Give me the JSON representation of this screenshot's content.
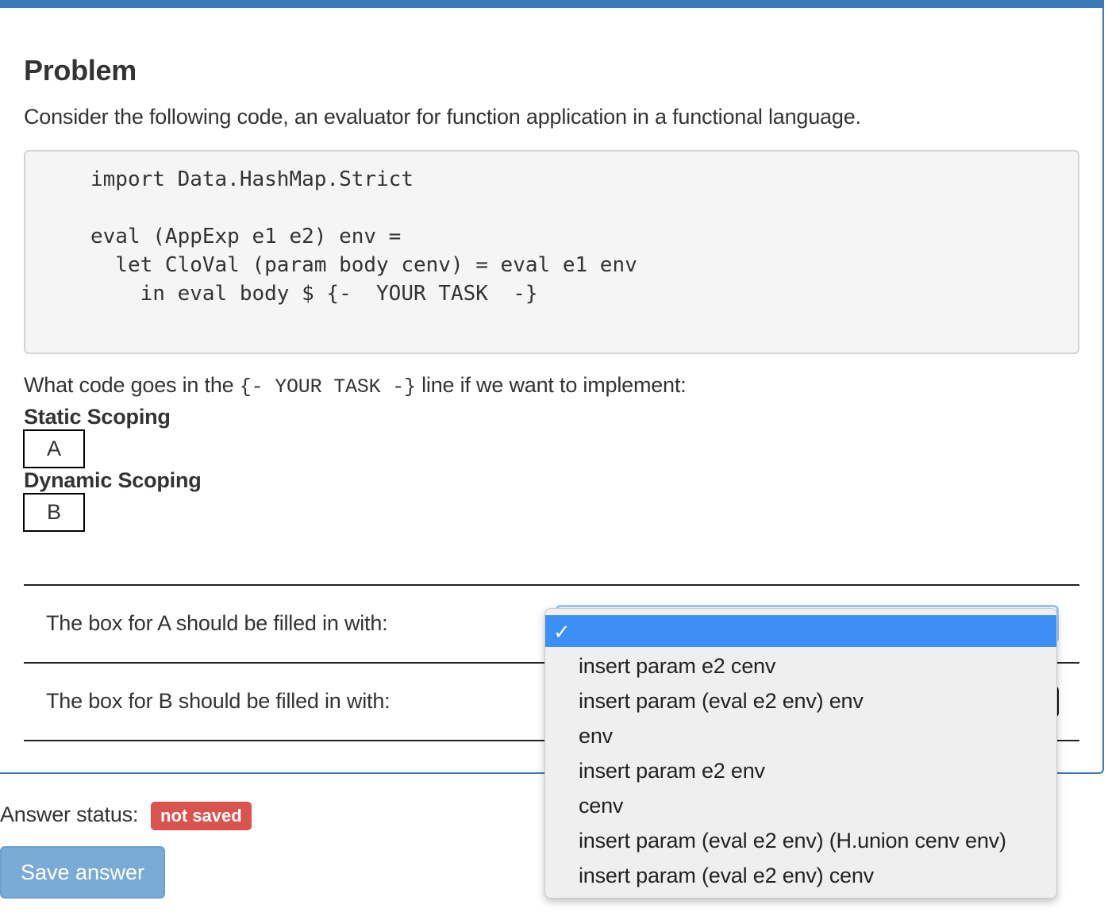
{
  "problem": {
    "title": "Problem",
    "intro": "Consider the following code, an evaluator for function application in a functional language.",
    "code_lines": [
      "import Data.HashMap.Strict",
      "eval (AppExp e1 e2) env =",
      "  let CloVal (param body cenv) = eval e1 env",
      "    in eval body $ {-  YOUR TASK  -}"
    ],
    "question_before": "What code goes in the ",
    "question_code": "{- YOUR TASK -}",
    "question_after": " line if we want to implement:",
    "static_label": "Static Scoping",
    "box_a": "A",
    "dynamic_label": "Dynamic Scoping",
    "box_b": "B"
  },
  "rows": {
    "a_label": "The box for A should be filled in with:",
    "b_label": "The box for B should be filled in with:"
  },
  "dropdown": {
    "selected_mark": "✓",
    "options": [
      "insert param e2 cenv",
      "insert param (eval e2 env) env",
      "env",
      "insert param e2 env",
      "cenv",
      "insert param (eval e2 env) (H.union cenv env)",
      "insert param (eval e2 env) cenv"
    ]
  },
  "footer": {
    "status_label": "Answer status:",
    "status_badge": "not saved",
    "save_button": "Save answer"
  },
  "colors": {
    "header_bar": "#3a7ab8",
    "badge": "#d9534f",
    "save_button": "#7aaad6",
    "dropdown_highlight": "#3b8ff5"
  }
}
